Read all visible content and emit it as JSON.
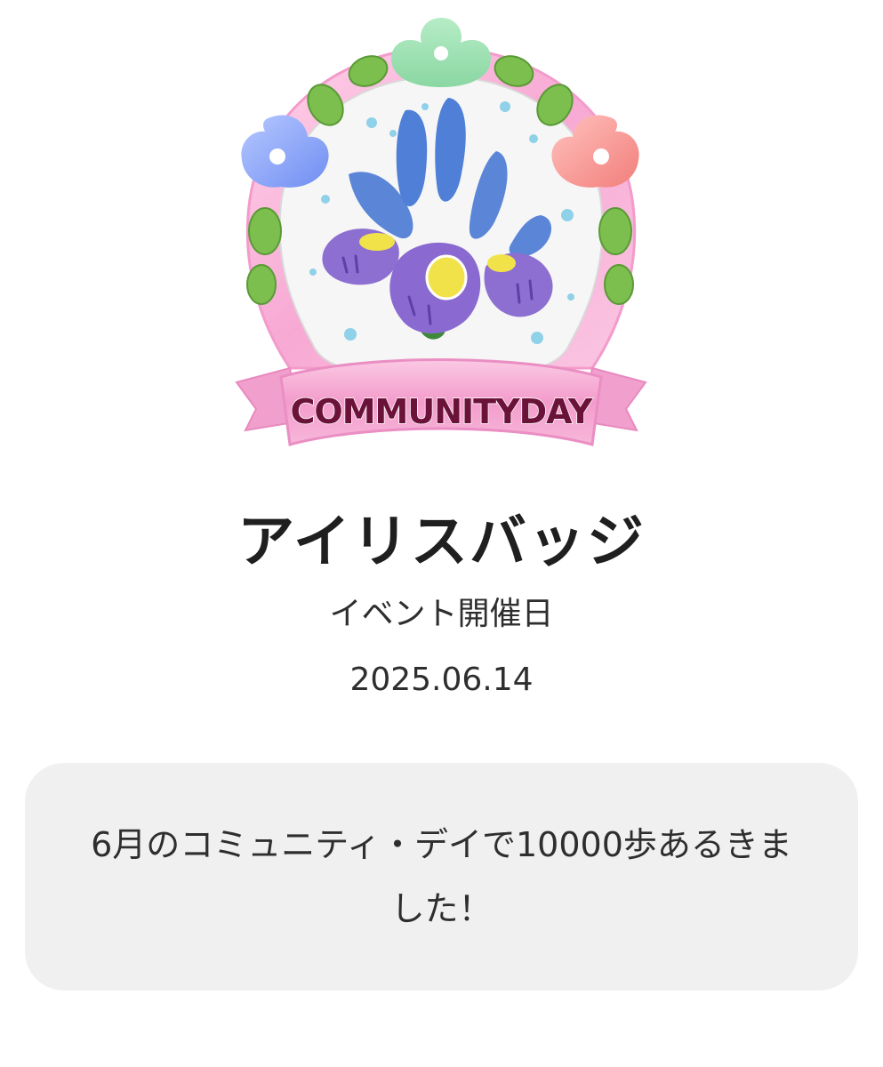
{
  "badge": {
    "icon": "iris-flower-icon",
    "ribbon_text": "COMMUNITYDAY"
  },
  "title": "アイリスバッジ",
  "date_label": "イベント開催日",
  "date_value": "2025.06.14",
  "description": "6月のコミュニティ・デイで10000歩あるきました！",
  "colors": {
    "title": "#1f1f1f",
    "text": "#2e2e2e",
    "card_bg": "#f0f0f0",
    "ribbon_pink": "#f4a6cf",
    "ribbon_text": "#6b1238",
    "iris_purple": "#8d6fd1",
    "iris_blue": "#5b86d8",
    "leaf_green": "#78b94a"
  }
}
